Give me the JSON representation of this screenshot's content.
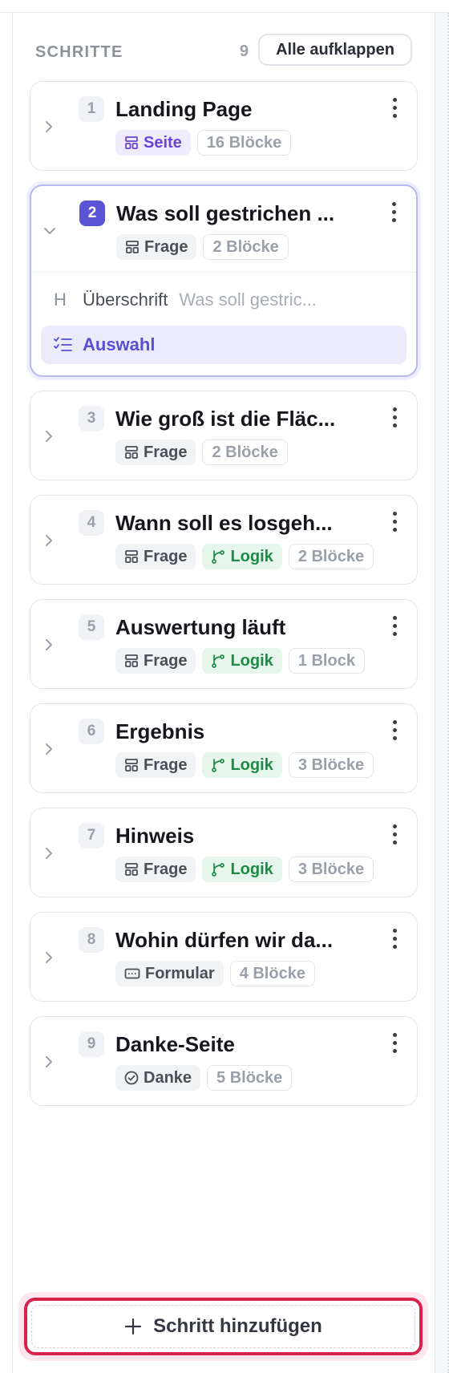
{
  "header": {
    "title": "SCHRITTE",
    "count": "9",
    "expand_all_label": "Alle aufklappen"
  },
  "steps": [
    {
      "number": "1",
      "title": "Landing Page",
      "type": "Seite",
      "type_icon": "layout-icon",
      "logic": null,
      "blocks": "16 Blöcke",
      "expanded": false
    },
    {
      "number": "2",
      "title": "Was soll gestrichen ...",
      "type": "Frage",
      "type_icon": "layout-icon",
      "logic": null,
      "blocks": "2 Blöcke",
      "expanded": true,
      "sub_items": [
        {
          "icon": "heading-icon",
          "icon_glyph": "H",
          "label": "Überschrift",
          "value": "Was soll gestric...",
          "selected": false
        },
        {
          "icon": "checklist-icon",
          "label": "Auswahl",
          "value": "",
          "selected": true
        }
      ]
    },
    {
      "number": "3",
      "title": "Wie groß ist die Fläc...",
      "type": "Frage",
      "type_icon": "layout-icon",
      "logic": null,
      "blocks": "2 Blöcke",
      "expanded": false
    },
    {
      "number": "4",
      "title": "Wann soll es losgeh...",
      "type": "Frage",
      "type_icon": "layout-icon",
      "logic": "Logik",
      "blocks": "2 Blöcke",
      "expanded": false
    },
    {
      "number": "5",
      "title": "Auswertung läuft",
      "type": "Frage",
      "type_icon": "layout-icon",
      "logic": "Logik",
      "blocks": "1 Block",
      "expanded": false
    },
    {
      "number": "6",
      "title": "Ergebnis",
      "type": "Frage",
      "type_icon": "layout-icon",
      "logic": "Logik",
      "blocks": "3 Blöcke",
      "expanded": false
    },
    {
      "number": "7",
      "title": "Hinweis",
      "type": "Frage",
      "type_icon": "layout-icon",
      "logic": "Logik",
      "blocks": "3 Blöcke",
      "expanded": false
    },
    {
      "number": "8",
      "title": "Wohin dürfen wir da...",
      "type": "Formular",
      "type_icon": "form-icon",
      "logic": null,
      "blocks": "4 Blöcke",
      "expanded": false
    },
    {
      "number": "9",
      "title": "Danke-Seite",
      "type": "Danke",
      "type_icon": "check-circle-icon",
      "logic": null,
      "blocks": "5 Blöcke",
      "expanded": false
    }
  ],
  "add_step": {
    "icon": "plus-icon",
    "label": "Schritt hinzufügen"
  },
  "colors": {
    "accent": "#5b55d6",
    "selected_bg": "#ecebfc",
    "logic_green": "#1c8b45",
    "seite_purple": "#6a43d3",
    "add_button_border": "#d8224c"
  }
}
